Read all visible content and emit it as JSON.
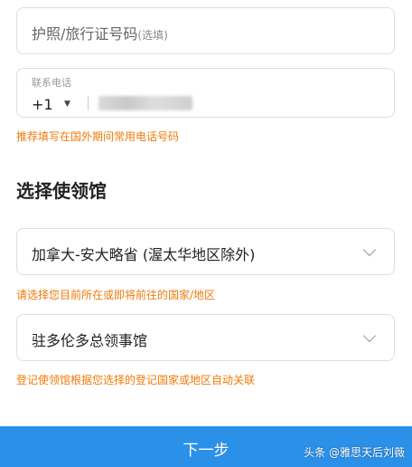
{
  "passport": {
    "label": "护照/旅行证号码",
    "optional": "(选填)"
  },
  "phone": {
    "label": "联系电话",
    "country_code": "+1",
    "caret": "▼",
    "number_masked": ""
  },
  "hints": {
    "phone_hint": "推荐填写在国外期间常用电话号码",
    "country_hint": "请选择您目前所在或即将前往的国家/地区",
    "consulate_hint": "登记使领馆根据您选择的登记国家或地区自动关联"
  },
  "section_title": "选择使领馆",
  "country_select": {
    "value": "加拿大-安大略省 (渥太华地区除外)",
    "icon": "chevron-down-icon"
  },
  "consulate_select": {
    "value": "驻多伦多总领事馆",
    "icon": "chevron-down-icon"
  },
  "next_button": {
    "label": "下一步"
  },
  "watermark": "头条 @雅思天后刘薇",
  "colors": {
    "accent": "#2b90e8",
    "hint": "#f07a0a",
    "border": "#dcdfe4"
  }
}
